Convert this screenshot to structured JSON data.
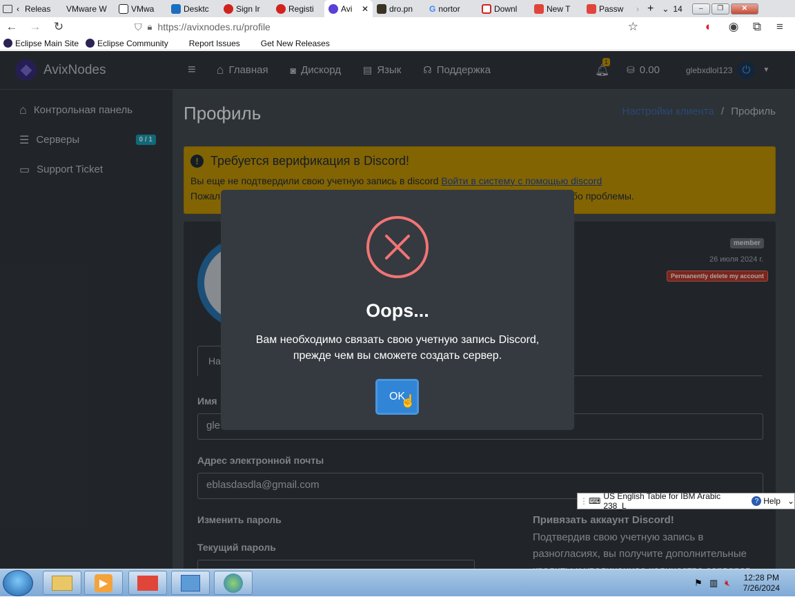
{
  "browser": {
    "tabs": [
      "Releas",
      "VMware W",
      "VMwa",
      "Desktc",
      "Sign Ir",
      "Registi",
      "Avi",
      "dro.pn",
      "nortor",
      "Downl",
      "New T",
      "Passw"
    ],
    "tab_count": "14",
    "url": "https://avixnodes.ru/profile",
    "bookmarks": [
      "Eclipse Main Site",
      "Eclipse Community",
      "Report Issues",
      "Get New Releases"
    ]
  },
  "site": {
    "brand": "AvixNodes",
    "sidebar": [
      {
        "label": "Контрольная панель"
      },
      {
        "label": "Серверы",
        "badge": "0 / 1"
      },
      {
        "label": "Support Ticket"
      }
    ],
    "topnav": [
      "Главная",
      "Дискорд",
      "Язык",
      "Поддержка"
    ],
    "notification_count": "1",
    "balance": "0.00",
    "username": "glebxdlol123"
  },
  "content": {
    "title": "Профиль",
    "breadcrumb_link": "Настройки клиента",
    "breadcrumb_sep": "/",
    "breadcrumb_current": "Профиль",
    "alert": {
      "title": "Требуется верификация в Discord!",
      "line1": "Вы еще не подтвердили свою учетную запись в discord",
      "line1_link": "Войти в систему с помощью discord",
      "line2_start": "Пожал",
      "line2_end": "бо проблемы."
    },
    "card": {
      "role_badge": "member",
      "date": "26 июля 2024 г.",
      "delete_badge": "Permanently delete my account",
      "tab_partial": "На",
      "name_label": "Имя",
      "name_value": "gle",
      "email_label": "Адрес электронной почты",
      "email_value": "eblasdasdla@gmail.com",
      "change_password": "Изменить пароль",
      "current_password": "Текущий пароль",
      "discord_heading": "Привязать аккаунт Discord!",
      "discord_text": "Подтвердив свою учетную запись в разногласиях, вы получите дополнительные кредиты и увеличенное количество серверов"
    }
  },
  "modal": {
    "title": "Oops...",
    "text": "Вам необходимо связать свою учетную запись Discord, прежде чем вы сможете создать сервер.",
    "ok": "OK"
  },
  "langbar": {
    "layout": "US English Table for IBM Arabic 238_L",
    "help": "Help"
  },
  "taskbar": {
    "time": "12:28 PM",
    "date": "7/26/2024"
  }
}
